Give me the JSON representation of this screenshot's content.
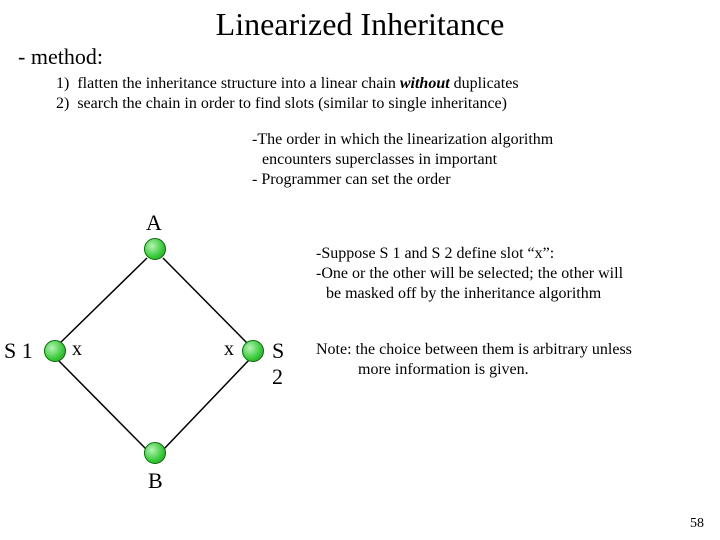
{
  "title": "Linearized Inheritance",
  "method_label": "- method:",
  "steps": {
    "s1_pre": "1)  flatten the inheritance structure into a linear chain ",
    "s1_em": "without",
    "s1_post": " duplicates",
    "s2": "2)  search the chain in order to find slots (similar to single inheritance)"
  },
  "note1": {
    "l1": "-The order in which the linearization algorithm",
    "l2": "encounters superclasses in important",
    "l3": "- Programmer can set the order"
  },
  "note2": {
    "l1": "-Suppose S 1 and S 2 define slot “x”:",
    "l2": "-One or the other will be selected; the other will",
    "l3": "be masked off by the inheritance algorithm"
  },
  "note3": {
    "l1": "Note:  the choice between them is arbitrary unless",
    "l2": "more information is given."
  },
  "labels": {
    "A": "A",
    "B": "B",
    "S1": "S 1",
    "S2": "S 2",
    "x": "x"
  },
  "page": "58"
}
